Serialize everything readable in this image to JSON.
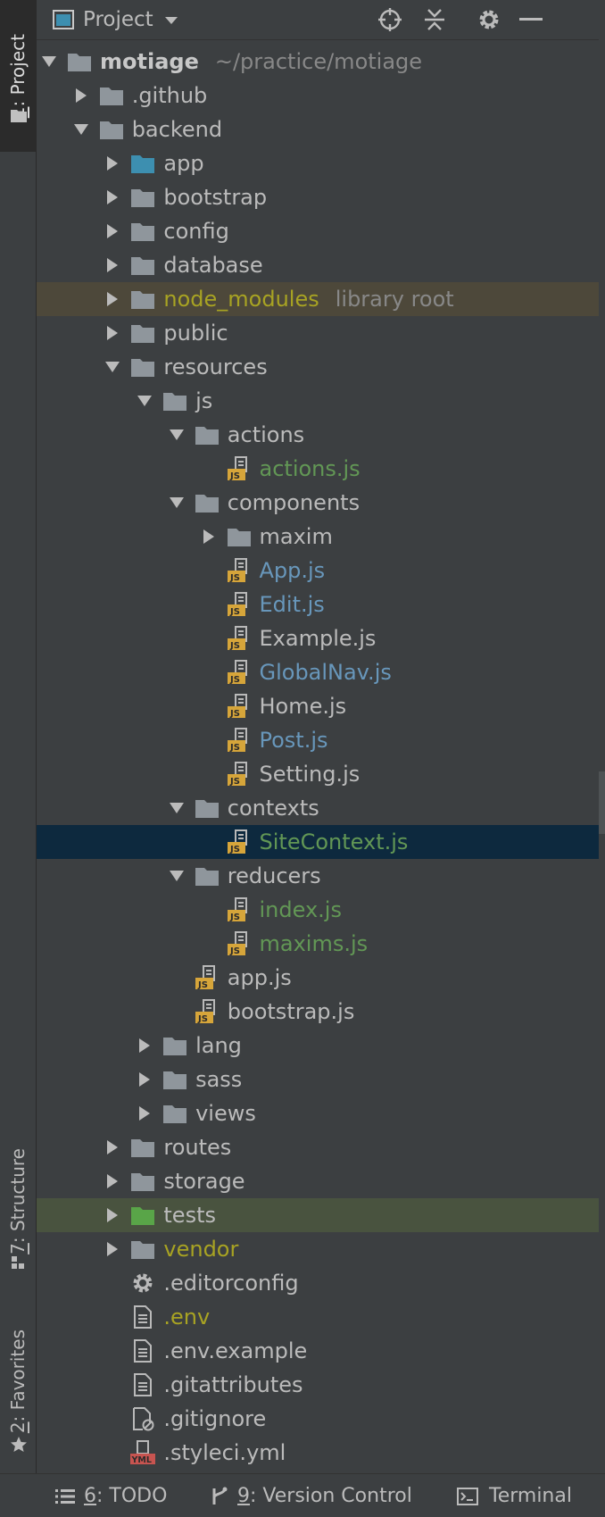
{
  "left_strip": {
    "project_tab": {
      "number": "1",
      "label": ": Project"
    },
    "structure_tab": {
      "number": "7",
      "label": ": Structure"
    },
    "favorites_tab": {
      "number": "2",
      "label": ": Favorites"
    }
  },
  "header": {
    "title": "Project",
    "icons": [
      "target-icon",
      "collapse-all-icon",
      "gear-icon",
      "minimize-icon"
    ]
  },
  "tree": [
    {
      "label": "motiage",
      "sublabel": "~/practice/motiage",
      "depth": 0,
      "expanded": true,
      "icon": "folder-icon",
      "color": "white",
      "bold": true
    },
    {
      "label": ".github",
      "depth": 1,
      "expanded": false,
      "icon": "folder-icon"
    },
    {
      "label": "backend",
      "depth": 1,
      "expanded": true,
      "icon": "folder-icon"
    },
    {
      "label": "app",
      "depth": 2,
      "expanded": false,
      "icon": "folder-blue-icon"
    },
    {
      "label": "bootstrap",
      "depth": 2,
      "expanded": false,
      "icon": "folder-icon"
    },
    {
      "label": "config",
      "depth": 2,
      "expanded": false,
      "icon": "folder-icon"
    },
    {
      "label": "database",
      "depth": 2,
      "expanded": false,
      "icon": "folder-icon"
    },
    {
      "label": "node_modules",
      "sublabel": "library root",
      "depth": 2,
      "expanded": false,
      "icon": "folder-icon",
      "color": "olive",
      "highlight": "modules"
    },
    {
      "label": "public",
      "depth": 2,
      "expanded": false,
      "icon": "folder-icon"
    },
    {
      "label": "resources",
      "depth": 2,
      "expanded": true,
      "icon": "folder-icon"
    },
    {
      "label": "js",
      "depth": 3,
      "expanded": true,
      "icon": "folder-icon"
    },
    {
      "label": "actions",
      "depth": 4,
      "expanded": true,
      "icon": "folder-icon"
    },
    {
      "label": "actions.js",
      "depth": 5,
      "icon": "js-file-icon",
      "color": "green"
    },
    {
      "label": "components",
      "depth": 4,
      "expanded": true,
      "icon": "folder-icon"
    },
    {
      "label": "maxim",
      "depth": 5,
      "expanded": false,
      "icon": "folder-icon"
    },
    {
      "label": "App.js",
      "depth": 5,
      "icon": "js-file-icon",
      "color": "blue"
    },
    {
      "label": "Edit.js",
      "depth": 5,
      "icon": "js-file-icon",
      "color": "blue"
    },
    {
      "label": "Example.js",
      "depth": 5,
      "icon": "js-file-icon"
    },
    {
      "label": "GlobalNav.js",
      "depth": 5,
      "icon": "js-file-icon",
      "color": "blue"
    },
    {
      "label": "Home.js",
      "depth": 5,
      "icon": "js-file-icon"
    },
    {
      "label": "Post.js",
      "depth": 5,
      "icon": "js-file-icon",
      "color": "blue"
    },
    {
      "label": "Setting.js",
      "depth": 5,
      "icon": "js-file-icon"
    },
    {
      "label": "contexts",
      "depth": 4,
      "expanded": true,
      "icon": "folder-icon"
    },
    {
      "label": "SiteContext.js",
      "depth": 5,
      "icon": "js-file-icon",
      "color": "green",
      "highlight": "selected"
    },
    {
      "label": "reducers",
      "depth": 4,
      "expanded": true,
      "icon": "folder-icon"
    },
    {
      "label": "index.js",
      "depth": 5,
      "icon": "js-file-icon",
      "color": "green"
    },
    {
      "label": "maxims.js",
      "depth": 5,
      "icon": "js-file-icon",
      "color": "green"
    },
    {
      "label": "app.js",
      "depth": 4,
      "icon": "js-file-icon"
    },
    {
      "label": "bootstrap.js",
      "depth": 4,
      "icon": "js-file-icon"
    },
    {
      "label": "lang",
      "depth": 3,
      "expanded": false,
      "icon": "folder-icon"
    },
    {
      "label": "sass",
      "depth": 3,
      "expanded": false,
      "icon": "folder-icon"
    },
    {
      "label": "views",
      "depth": 3,
      "expanded": false,
      "icon": "folder-icon"
    },
    {
      "label": "routes",
      "depth": 2,
      "expanded": false,
      "icon": "folder-icon"
    },
    {
      "label": "storage",
      "depth": 2,
      "expanded": false,
      "icon": "folder-icon"
    },
    {
      "label": "tests",
      "depth": 2,
      "expanded": false,
      "icon": "folder-green-icon",
      "highlight": "tests"
    },
    {
      "label": "vendor",
      "depth": 2,
      "expanded": false,
      "icon": "folder-icon",
      "color": "olive"
    },
    {
      "label": ".editorconfig",
      "depth": 2,
      "icon": "gear-file-icon"
    },
    {
      "label": ".env",
      "depth": 2,
      "icon": "text-file-icon",
      "color": "olive"
    },
    {
      "label": ".env.example",
      "depth": 2,
      "icon": "text-file-icon"
    },
    {
      "label": ".gitattributes",
      "depth": 2,
      "icon": "text-file-icon"
    },
    {
      "label": ".gitignore",
      "depth": 2,
      "icon": "ignore-file-icon"
    },
    {
      "label": ".styleci.yml",
      "depth": 2,
      "icon": "yml-file-icon"
    }
  ],
  "bottom_bar": {
    "todo": {
      "number": "6",
      "label": ": TODO"
    },
    "version_control": {
      "number": "9",
      "label": ": Version Control"
    },
    "terminal": {
      "label": "Terminal"
    }
  }
}
